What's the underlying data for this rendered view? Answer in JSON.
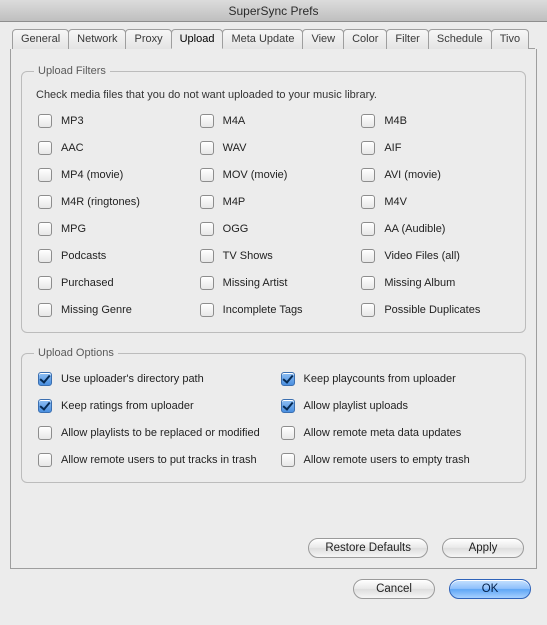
{
  "window": {
    "title": "SuperSync Prefs"
  },
  "tabs": [
    {
      "label": "General"
    },
    {
      "label": "Network"
    },
    {
      "label": "Proxy"
    },
    {
      "label": "Upload",
      "active": true
    },
    {
      "label": "Meta Update"
    },
    {
      "label": "View"
    },
    {
      "label": "Color"
    },
    {
      "label": "Filter"
    },
    {
      "label": "Schedule"
    },
    {
      "label": "Tivo"
    }
  ],
  "filters": {
    "legend": "Upload Filters",
    "hint": "Check media files that you do not want uploaded to your music library.",
    "items": [
      {
        "label": "MP3"
      },
      {
        "label": "M4A"
      },
      {
        "label": "M4B"
      },
      {
        "label": "AAC"
      },
      {
        "label": "WAV"
      },
      {
        "label": "AIF"
      },
      {
        "label": "MP4 (movie)"
      },
      {
        "label": "MOV (movie)"
      },
      {
        "label": "AVI (movie)"
      },
      {
        "label": "M4R (ringtones)"
      },
      {
        "label": "M4P"
      },
      {
        "label": "M4V"
      },
      {
        "label": "MPG"
      },
      {
        "label": "OGG"
      },
      {
        "label": "AA (Audible)"
      },
      {
        "label": "Podcasts"
      },
      {
        "label": "TV Shows"
      },
      {
        "label": "Video Files (all)"
      },
      {
        "label": "Purchased"
      },
      {
        "label": "Missing Artist"
      },
      {
        "label": "Missing Album"
      },
      {
        "label": "Missing Genre"
      },
      {
        "label": "Incomplete Tags"
      },
      {
        "label": "Possible Duplicates"
      }
    ]
  },
  "options": {
    "legend": "Upload Options",
    "items": [
      {
        "label": "Use uploader's directory path",
        "checked": true
      },
      {
        "label": "Keep playcounts from uploader",
        "checked": true
      },
      {
        "label": "Keep ratings from uploader",
        "checked": true
      },
      {
        "label": "Allow playlist uploads",
        "checked": true
      },
      {
        "label": "Allow playlists to be replaced or modified",
        "checked": false
      },
      {
        "label": "Allow remote meta data updates",
        "checked": false
      },
      {
        "label": "Allow remote users to put tracks in trash",
        "checked": false
      },
      {
        "label": "Allow remote users to empty trash",
        "checked": false
      }
    ]
  },
  "buttons": {
    "restore": "Restore Defaults",
    "apply": "Apply",
    "cancel": "Cancel",
    "ok": "OK"
  }
}
